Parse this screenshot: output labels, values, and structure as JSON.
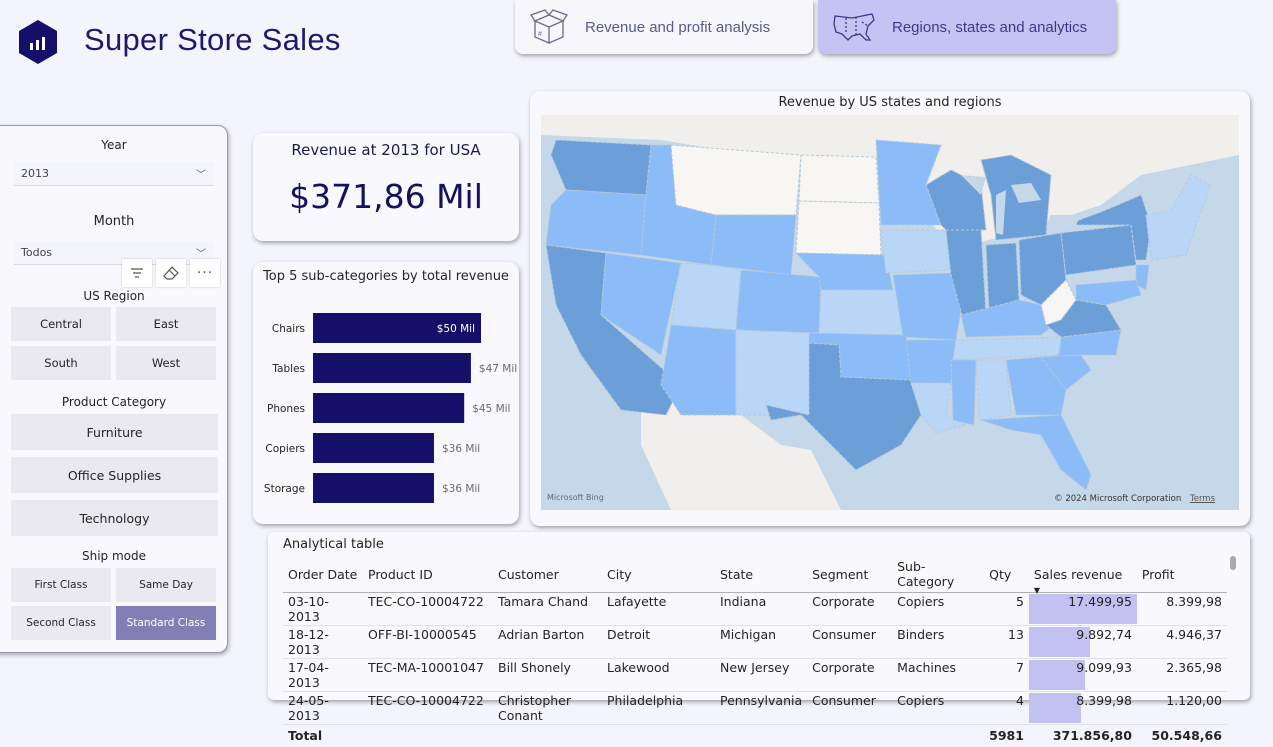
{
  "header": {
    "title": "Super Store Sales",
    "nav": [
      {
        "label": "Revenue and profit analysis",
        "icon": "box-icon"
      },
      {
        "label": "Regions, states and analytics",
        "icon": "us-map-icon"
      }
    ]
  },
  "slicers": {
    "year": {
      "label": "Year",
      "value": "2013"
    },
    "month": {
      "label": "Month",
      "value": "Todos"
    },
    "region": {
      "label": "US Region",
      "options": [
        "Central",
        "East",
        "South",
        "West"
      ]
    },
    "category": {
      "label": "Product Category",
      "options": [
        "Furniture",
        "Office Supplies",
        "Technology"
      ]
    },
    "ship": {
      "label": "Ship mode",
      "options": [
        "First Class",
        "Same Day",
        "Second Class",
        "Standard Class"
      ],
      "selected": "Standard Class"
    }
  },
  "kpi": {
    "label": "Revenue at 2013 for USA",
    "value": "$371,86 Mil"
  },
  "bar_chart": {
    "title": "Top 5 sub-categories by total revenue"
  },
  "chart_data": {
    "type": "bar",
    "orientation": "horizontal",
    "title": "Top 5 sub-categories by total revenue",
    "categories": [
      "Chairs",
      "Tables",
      "Phones",
      "Copiers",
      "Storage"
    ],
    "values": [
      50,
      47,
      45,
      36,
      36
    ],
    "labels": [
      "$50 Mil",
      "$47 Mil",
      "$45 Mil",
      "$36 Mil",
      "$36 Mil"
    ],
    "color": "#14106a"
  },
  "map": {
    "title": "Revenue by US states and regions",
    "attribution": "Microsoft Bing",
    "copyright": "© 2024 Microsoft Corporation",
    "terms": "Terms"
  },
  "table": {
    "title": "Analytical table",
    "columns": [
      "Order Date",
      "Product ID",
      "Customer",
      "City",
      "State",
      "Segment",
      "Sub-Category",
      "Qty",
      "Sales revenue",
      "Profit"
    ],
    "rows": [
      {
        "date": "03-10-2013",
        "pid": "TEC-CO-10004722",
        "customer": "Tamara Chand",
        "city": "Lafayette",
        "state": "Indiana",
        "segment": "Corporate",
        "sub": "Copiers",
        "qty": "5",
        "sales": "17.499,95",
        "sales_share": 1.0,
        "profit": "8.399,98"
      },
      {
        "date": "18-12-2013",
        "pid": "OFF-BI-10000545",
        "customer": "Adrian Barton",
        "city": "Detroit",
        "state": "Michigan",
        "segment": "Consumer",
        "sub": "Binders",
        "qty": "13",
        "sales": "9.892,74",
        "sales_share": 0.565,
        "profit": "4.946,37"
      },
      {
        "date": "17-04-2013",
        "pid": "TEC-MA-10001047",
        "customer": "Bill Shonely",
        "city": "Lakewood",
        "state": "New Jersey",
        "segment": "Corporate",
        "sub": "Machines",
        "qty": "7",
        "sales": "9.099,93",
        "sales_share": 0.52,
        "profit": "2.365,98"
      },
      {
        "date": "24-05-2013",
        "pid": "TEC-CO-10004722",
        "customer": "Christopher Conant",
        "city": "Philadelphia",
        "state": "Pennsylvania",
        "segment": "Consumer",
        "sub": "Copiers",
        "qty": "4",
        "sales": "8.399,98",
        "sales_share": 0.48,
        "profit": "1.120,00"
      }
    ],
    "total": {
      "label": "Total",
      "qty": "5981",
      "sales": "371.856,80",
      "profit": "50.548,66"
    }
  }
}
